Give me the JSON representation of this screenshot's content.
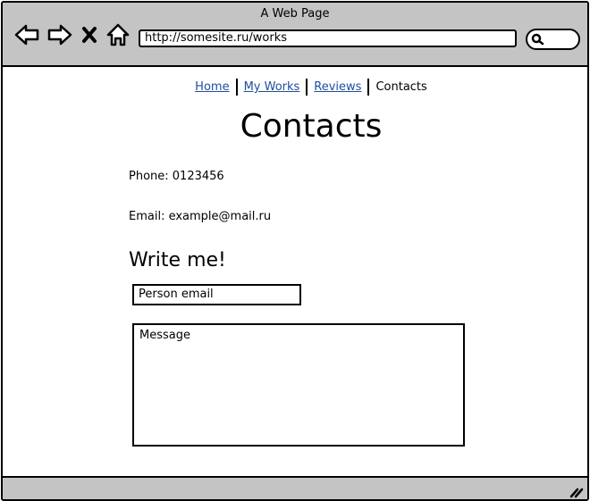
{
  "window": {
    "title": "A Web Page",
    "url": "http://somesite.ru/works"
  },
  "nav": {
    "items": [
      {
        "label": "Home",
        "link": true
      },
      {
        "label": "My Works",
        "link": true
      },
      {
        "label": "Reviews",
        "link": true
      },
      {
        "label": "Contacts",
        "link": false
      }
    ]
  },
  "content": {
    "heading": "Contacts",
    "phone": "Phone: 0123456",
    "email": "Email: example@mail.ru",
    "form_title": "Write me!",
    "email_placeholder": "Person email",
    "message_placeholder": "Message"
  },
  "colors": {
    "chrome": "#c4c4c4",
    "link": "#1f4e9c"
  },
  "icons": [
    "back-arrow-icon",
    "forward-arrow-icon",
    "close-icon",
    "home-icon",
    "search-icon",
    "resize-grip-icon"
  ]
}
